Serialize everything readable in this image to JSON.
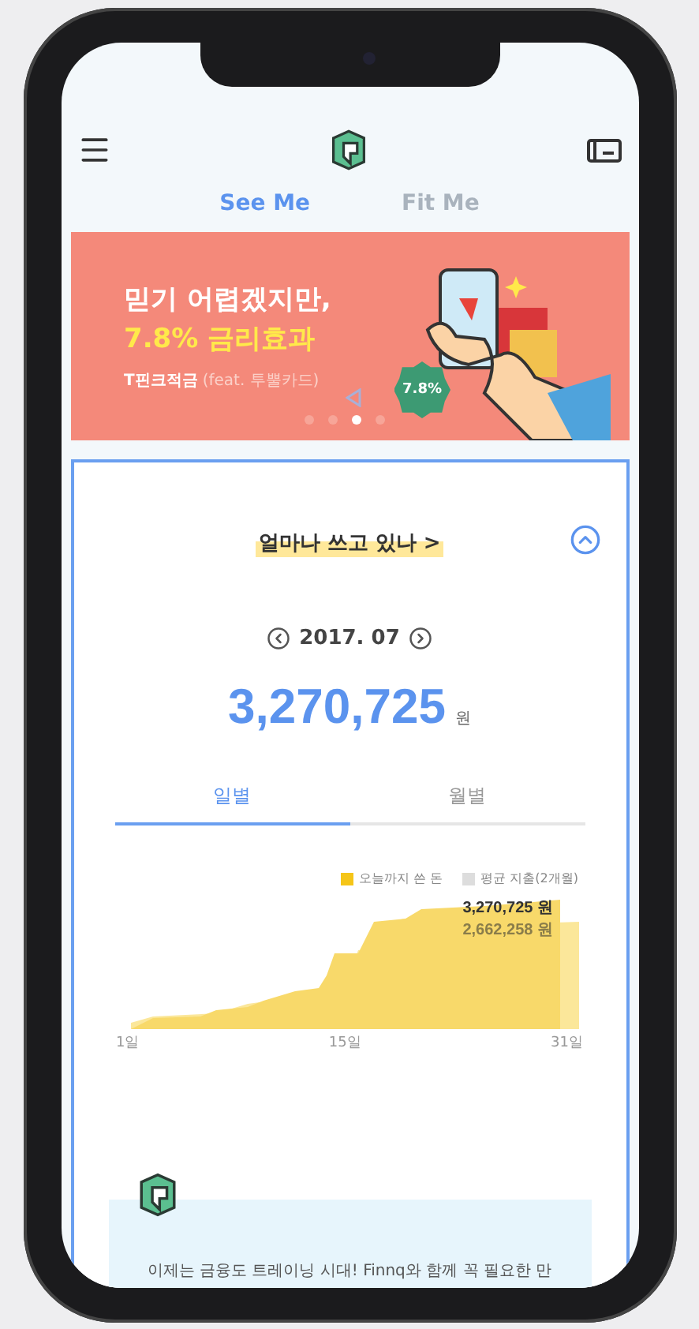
{
  "header": {
    "tabs": [
      {
        "label": "See Me",
        "selected": true
      },
      {
        "label": "Fit Me",
        "selected": false
      }
    ]
  },
  "banner": {
    "headline": "믿기 어렵겠지만,",
    "highlight": "7.8% 금리효과",
    "product": "T핀크적금",
    "product_note": "(feat. 투뿔카드)",
    "badge": "7.8%",
    "pager": [
      {
        "selected": false
      },
      {
        "selected": false
      },
      {
        "selected": true
      },
      {
        "selected": false
      }
    ]
  },
  "spending_card": {
    "title": "얼마나 쓰고 있나 >",
    "expanded": true,
    "month": "2017. 07",
    "amount": "3,270,725",
    "unit": "원",
    "tabs": [
      {
        "label": "일별",
        "selected": true
      },
      {
        "label": "월별",
        "selected": false
      }
    ],
    "legend": [
      {
        "label": "오늘까지 쓴 돈",
        "color": "#f5c518"
      },
      {
        "label": "평균 지출(2개월)",
        "color": "#dddddd"
      }
    ],
    "chart_labels": [
      {
        "value": "3,270,725",
        "unit": "원"
      },
      {
        "value": "2,662,258",
        "unit": "원"
      }
    ],
    "x_labels": [
      "1일",
      "15일",
      "31일"
    ]
  },
  "promo": {
    "text": "이제는 금융도 트레이닝 시대! Finnq와 함께 꼭 필요한 만"
  }
}
